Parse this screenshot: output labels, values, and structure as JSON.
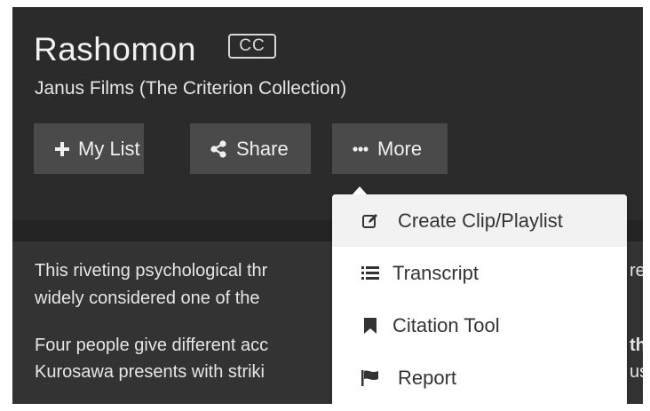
{
  "title": {
    "main": "Rashomon",
    "cc_badge": "CC",
    "studio": "Janus Films (The Criterion Collection)"
  },
  "actions": {
    "my_list": "My List",
    "share": "Share",
    "more": "More"
  },
  "description": {
    "line1": "This riveting psychological thr",
    "line2": "widely considered one of the",
    "line3": "Four people give different acc",
    "line4": "Kurosawa presents with striki",
    "fragment_right_1": "re",
    "fragment_right_3": "th",
    "fragment_right_4": "us"
  },
  "menu": {
    "items": [
      {
        "label": "Create Clip/Playlist",
        "icon": "edit-icon"
      },
      {
        "label": "Transcript",
        "icon": "list-icon"
      },
      {
        "label": "Citation Tool",
        "icon": "bookmark-icon"
      },
      {
        "label": "Report",
        "icon": "flag-icon"
      }
    ]
  },
  "colors": {
    "header_bg": "#2b2b2b",
    "body_bg": "#333333",
    "button_bg": "#4a4a4a",
    "menu_bg": "#ffffff",
    "menu_highlight": "#f2f2f2"
  }
}
